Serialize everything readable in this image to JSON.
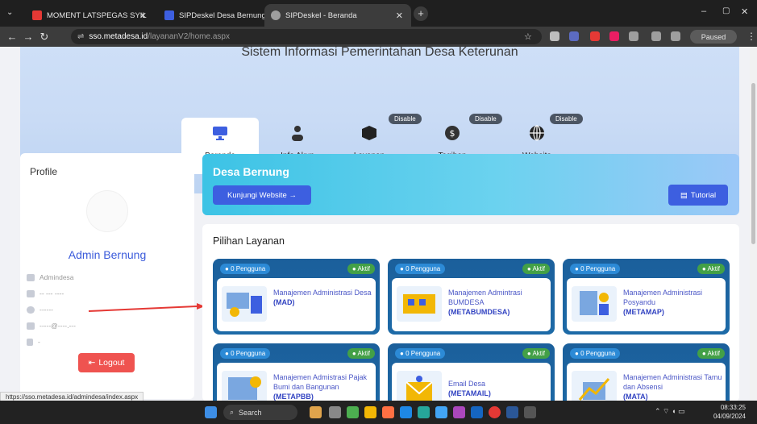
{
  "browser": {
    "tabs": [
      {
        "label": "MOMENT LATSPEGAS SYIL",
        "color": "#e53935"
      },
      {
        "label": "SIPDeskel Desa Bernung",
        "color": "#3d5fe0"
      },
      {
        "label": "SIPDeskel - Beranda",
        "color": "#9e9e9e"
      }
    ],
    "url_host": "sso.metadesa.id",
    "url_path": "/layananV2/home.aspx",
    "paused_label": "Paused",
    "status_url": "https://sso.metadesa.id/admindesa/index.aspx"
  },
  "hero": {
    "title": "Sistem Informasi Pemerintahan Desa Keterunan",
    "nav": [
      {
        "label": "Beranda",
        "icon": "monitor-icon",
        "badge": "",
        "active": true
      },
      {
        "label": "Info Akun",
        "icon": "user-icon",
        "badge": "",
        "active": false
      },
      {
        "label": "Layanan",
        "icon": "box-icon",
        "badge": "Disable",
        "active": false
      },
      {
        "label": "Tagihan",
        "icon": "dollar-icon",
        "badge": "Disable",
        "active": false
      },
      {
        "label": "Website",
        "icon": "globe-icon",
        "badge": "Disable",
        "active": false
      }
    ]
  },
  "profile": {
    "title": "Profile",
    "name": "Admin Bernung",
    "role": "Admindesa",
    "date": "-- --- ----",
    "location": "------",
    "email": "-----@----.---",
    "phone": "-",
    "logout": "Logout"
  },
  "banner": {
    "title": "Desa Bernung",
    "visit": "Kunjungi Website →",
    "tutorial": "Tutorial"
  },
  "services": {
    "title": "Pilihan Layanan",
    "cards": [
      {
        "users": "0 Pengguna",
        "status": "Aktif",
        "name": "Manajemen Administrasi Desa",
        "code": "(MAD)"
      },
      {
        "users": "0 Pengguna",
        "status": "Aktif",
        "name": "Manajemen Admintrasi BUMDESA",
        "code": "(METABUMDESA)"
      },
      {
        "users": "0 Pengguna",
        "status": "Aktif",
        "name": "Manajemen Administrasi Posyandu",
        "code": "(METAMAP)"
      },
      {
        "users": "0 Pengguna",
        "status": "Aktif",
        "name": "Manajemen Admistrasi Pajak Bumi dan Bangunan",
        "code": "(METAPBB)"
      },
      {
        "users": "0 Pengguna",
        "status": "Aktif",
        "name": "Email Desa",
        "code": "(METAMAIL)"
      },
      {
        "users": "0 Pengguna",
        "status": "Aktif",
        "name": "Manajemen Administrasi Tamu dan Absensi",
        "code": "(MATA)"
      }
    ]
  },
  "taskbar": {
    "search": "Search",
    "time": "08:33:25",
    "date": "04/09/2024"
  },
  "colors": {
    "accent": "#3d5fe0",
    "card": "#1b5f9b",
    "active": "#43a047",
    "logout": "#ef5350"
  }
}
